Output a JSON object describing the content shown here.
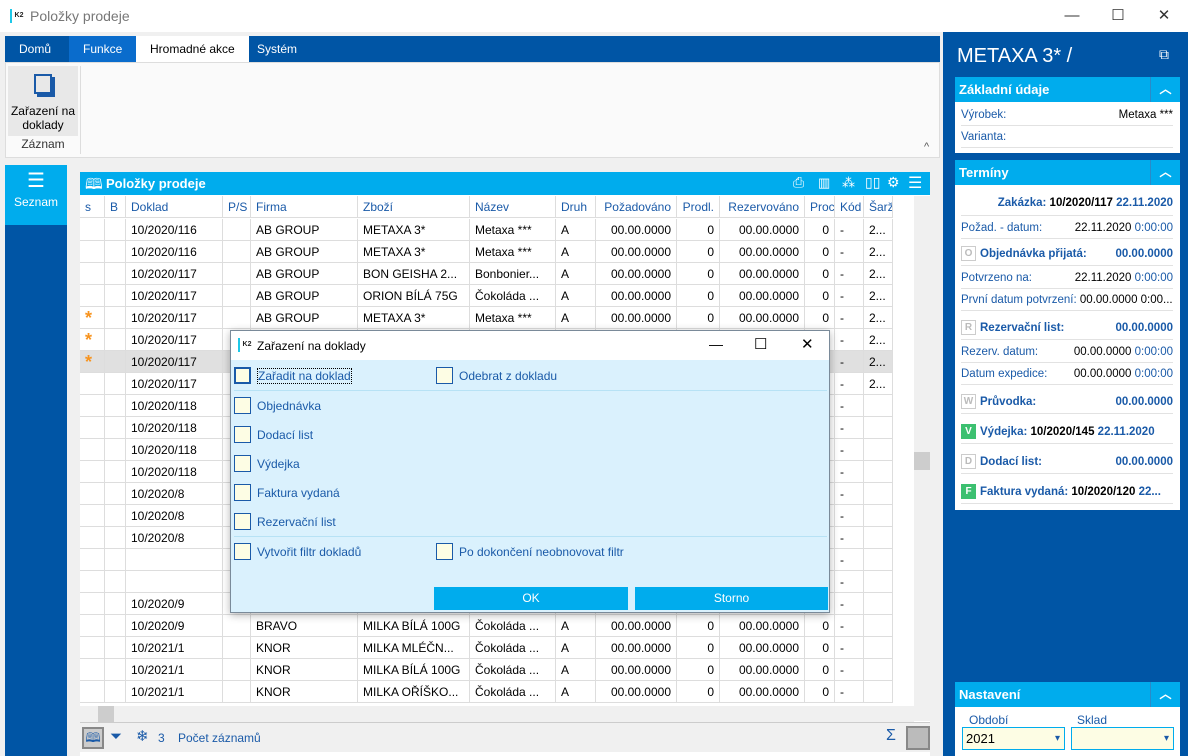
{
  "window": {
    "title": "Položky prodeje",
    "minimize": "—",
    "maximize": "☐",
    "close": "✕"
  },
  "tabs": [
    "Domů",
    "Funkce",
    "Hromadné akce",
    "Systém"
  ],
  "ribbon": {
    "button_label": "Zařazení na doklady",
    "group_label": "Záznam"
  },
  "nav": {
    "item": "Seznam"
  },
  "grid": {
    "title": "Položky prodeje",
    "columns": [
      "s",
      "B",
      "Doklad",
      "P/S",
      "Firma",
      "Zboží",
      "Název",
      "Druh",
      "Požadováno",
      "Prodl.",
      "Rezervováno",
      "Proc",
      "Kód",
      "Šarže"
    ],
    "rows": [
      [
        "",
        "",
        "10/2020/116",
        "",
        "AB GROUP",
        "METAXA 3*",
        "Metaxa ***",
        "A",
        "00.00.0000",
        "0",
        "00.00.0000",
        "0",
        "-",
        "2..."
      ],
      [
        "",
        "",
        "10/2020/116",
        "",
        "AB GROUP",
        "METAXA 3*",
        "Metaxa ***",
        "A",
        "00.00.0000",
        "0",
        "00.00.0000",
        "0",
        "-",
        "2..."
      ],
      [
        "",
        "",
        "10/2020/117",
        "",
        "AB GROUP",
        "BON GEISHA 2...",
        "Bonbonier...",
        "A",
        "00.00.0000",
        "0",
        "00.00.0000",
        "0",
        "-",
        "2..."
      ],
      [
        "",
        "",
        "10/2020/117",
        "",
        "AB GROUP",
        "ORION BÍLÁ 75G",
        "Čokoláda ...",
        "A",
        "00.00.0000",
        "0",
        "00.00.0000",
        "0",
        "-",
        "2..."
      ],
      [
        "*",
        "",
        "10/2020/117",
        "",
        "AB GROUP",
        "METAXA 3*",
        "Metaxa ***",
        "A",
        "00.00.0000",
        "0",
        "00.00.0000",
        "0",
        "-",
        "2..."
      ],
      [
        "*",
        "",
        "10/2020/117",
        "",
        "",
        "",
        "",
        "",
        "",
        "",
        "",
        "",
        "-",
        "2..."
      ],
      [
        "*",
        "",
        "10/2020/117",
        "",
        "",
        "",
        "",
        "",
        "",
        "",
        "",
        "",
        "-",
        "2..."
      ],
      [
        "",
        "",
        "10/2020/117",
        "",
        "",
        "",
        "",
        "",
        "",
        "",
        "",
        "",
        "-",
        "2..."
      ],
      [
        "",
        "",
        "10/2020/118",
        "",
        "",
        "",
        "",
        "",
        "",
        "",
        "",
        "",
        "-",
        ""
      ],
      [
        "",
        "",
        "10/2020/118",
        "",
        "",
        "",
        "",
        "",
        "",
        "",
        "",
        "",
        "-",
        ""
      ],
      [
        "",
        "",
        "10/2020/118",
        "",
        "",
        "",
        "",
        "",
        "",
        "",
        "",
        "",
        "-",
        ""
      ],
      [
        "",
        "",
        "10/2020/118",
        "",
        "",
        "",
        "",
        "",
        "",
        "",
        "",
        "",
        "-",
        ""
      ],
      [
        "",
        "",
        "10/2020/8",
        "",
        "",
        "",
        "",
        "",
        "",
        "",
        "",
        "",
        "-",
        ""
      ],
      [
        "",
        "",
        "10/2020/8",
        "",
        "",
        "",
        "",
        "",
        "",
        "",
        "",
        "",
        "-",
        ""
      ],
      [
        "",
        "",
        "10/2020/8",
        "",
        "",
        "",
        "",
        "",
        "",
        "",
        "",
        "",
        "-",
        ""
      ],
      [
        "",
        "",
        "",
        "",
        "",
        "",
        "",
        "",
        "",
        "",
        "",
        "",
        "-",
        ""
      ],
      [
        "",
        "",
        "",
        "",
        "",
        "",
        "",
        "",
        "",
        "",
        "",
        "",
        "-",
        ""
      ],
      [
        "",
        "",
        "10/2020/9",
        "",
        "",
        "",
        "",
        "",
        "",
        "",
        "",
        "",
        "-",
        ""
      ],
      [
        "",
        "",
        "10/2020/9",
        "",
        "BRAVO",
        "MILKA BÍLÁ 100G",
        "Čokoláda ...",
        "A",
        "00.00.0000",
        "0",
        "00.00.0000",
        "0",
        "-",
        ""
      ],
      [
        "",
        "",
        "10/2021/1",
        "",
        "KNOR",
        "MILKA MLÉČN...",
        "Čokoláda ...",
        "A",
        "00.00.0000",
        "0",
        "00.00.0000",
        "0",
        "-",
        ""
      ],
      [
        "",
        "",
        "10/2021/1",
        "",
        "KNOR",
        "MILKA BÍLÁ 100G",
        "Čokoláda ...",
        "A",
        "00.00.0000",
        "0",
        "00.00.0000",
        "0",
        "-",
        ""
      ],
      [
        "",
        "",
        "10/2021/1",
        "",
        "KNOR",
        "MILKA OŘÍŠKO...",
        "Čokoláda ...",
        "A",
        "00.00.0000",
        "0",
        "00.00.0000",
        "0",
        "-",
        ""
      ]
    ],
    "selected_row": 7
  },
  "status": {
    "count": "3",
    "records_label": "Počet záznamů",
    "sum": "Σ"
  },
  "dialog": {
    "title": "Zařazení na doklady",
    "assign": "Zařadit na doklad",
    "remove": "Odebrat z dokladu",
    "doc_types": [
      "Objednávka",
      "Dodací list",
      "Výdejka",
      "Faktura vydaná",
      "Rezervační list"
    ],
    "create_filter": "Vytvořit filtr dokladů",
    "no_refresh": "Po dokončení neobnovovat filtr",
    "ok": "OK",
    "cancel": "Storno"
  },
  "right": {
    "title": "METAXA 3* /",
    "basic": {
      "header": "Základní údaje",
      "product_label": "Výrobek:",
      "product_value": "Metaxa ***",
      "variant_label": "Varianta:"
    },
    "terms": {
      "header": "Termíny",
      "order_label": "Zakázka:",
      "order_no": "10/2020/117",
      "order_date": "22.11.2020",
      "req_label": "Požad. - datum:",
      "req_date": "22.11.2020",
      "req_time": "0:00:00",
      "po_badge": "O",
      "po_label": "Objednávka přijatá:",
      "po_value": "00.00.0000",
      "conf_label": "Potvrzeno na:",
      "conf_date": "22.11.2020",
      "conf_time": "0:00:00",
      "first_label": "První datum potvrzení:",
      "first_value": "00.00.0000 0:00...",
      "res_badge": "R",
      "res_label": "Rezervační list:",
      "res_value": "00.00.0000",
      "resd_label": "Rezerv. datum:",
      "resd_date": "00.00.0000",
      "resd_time": "0:00:00",
      "exp_label": "Datum expedice:",
      "exp_date": "00.00.0000",
      "exp_time": "0:00:00",
      "w_badge": "W",
      "w_label": "Průvodka:",
      "w_value": "00.00.0000",
      "v_badge": "V",
      "v_label": "Výdejka:",
      "v_no": "10/2020/145",
      "v_date": "22.11.2020",
      "d_badge": "D",
      "d_label": "Dodací list:",
      "d_value": "00.00.0000",
      "f_badge": "F",
      "f_label": "Faktura vydaná:",
      "f_no": "10/2020/120",
      "f_date": "22..."
    },
    "settings": {
      "header": "Nastavení",
      "period_label": "Období",
      "period_value": "2021",
      "store_label": "Sklad",
      "store_value": ""
    }
  },
  "colors": {
    "brand_dark": "#0055a5",
    "accent": "#00aced",
    "dialog_bg": "#daf1fd",
    "star": "#f7931e"
  }
}
